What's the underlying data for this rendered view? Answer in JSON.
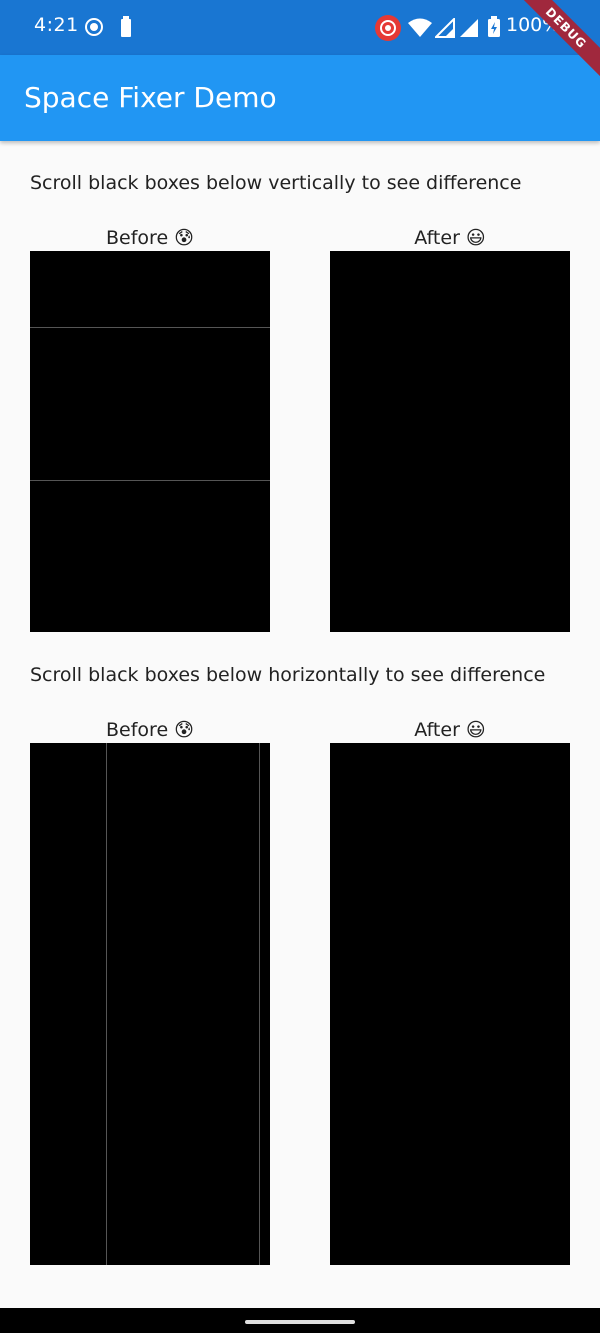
{
  "status_bar": {
    "time": "4:21",
    "battery_text": "100%",
    "icons": [
      "screen-record-icon",
      "battery-small-icon",
      "recording-icon",
      "wifi-icon",
      "signal-icon",
      "signal-icon",
      "battery-icon"
    ]
  },
  "app_bar": {
    "title": "Space Fixer Demo",
    "background": "#2196f3"
  },
  "debug_banner": {
    "label": "DEBUG"
  },
  "vertical_section": {
    "description": "Scroll black boxes below vertically to see difference",
    "before_label": "Before 😰",
    "after_label": "After 😃"
  },
  "horizontal_section": {
    "description": "Scroll black boxes below horizontally to see difference",
    "before_label": "Before 😰",
    "after_label": "After 😃"
  }
}
